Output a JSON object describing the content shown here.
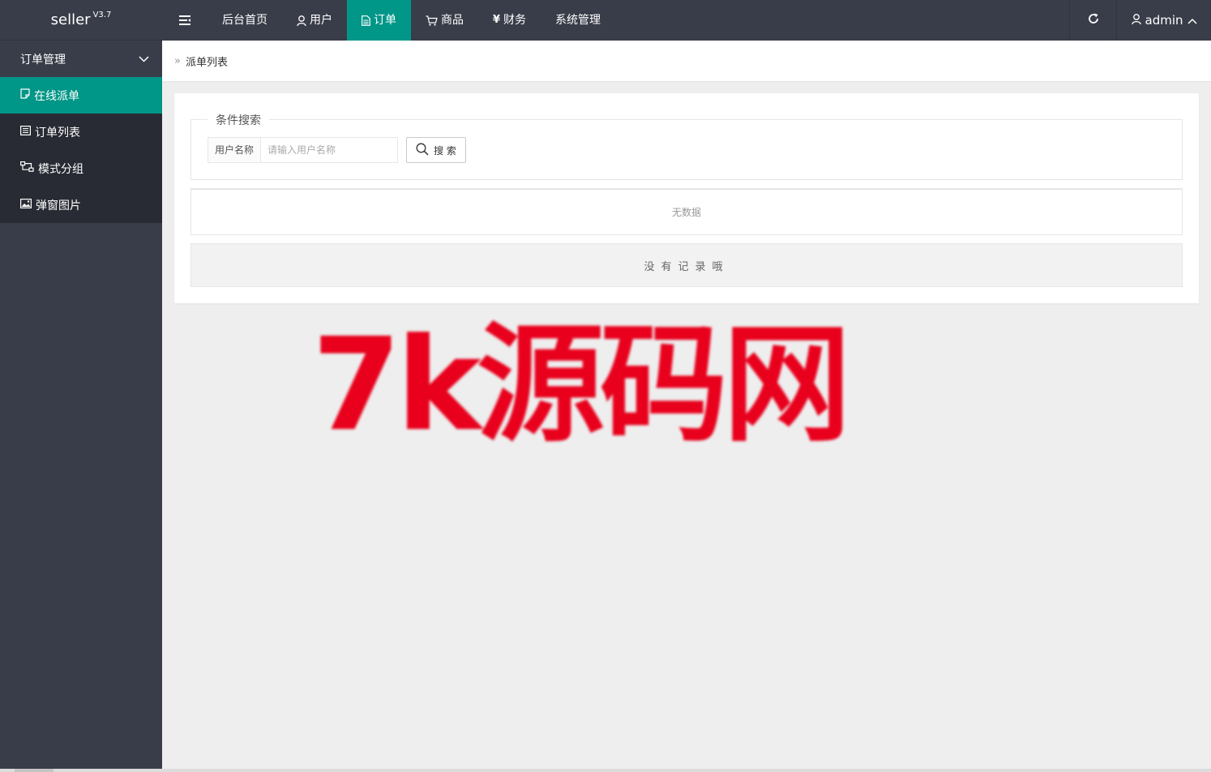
{
  "logo": {
    "name": "seller",
    "version": "V3.7"
  },
  "topnav": {
    "toggle_icon": "menu-toggle-icon",
    "items": [
      {
        "label": "后台首页",
        "icon": ""
      },
      {
        "label": "用户",
        "icon": "user-icon"
      },
      {
        "label": "订单",
        "icon": "file-icon",
        "active": true
      },
      {
        "label": "商品",
        "icon": "cart-icon"
      },
      {
        "label": "财务",
        "icon": "yen-icon"
      },
      {
        "label": "系统管理",
        "icon": ""
      }
    ]
  },
  "topright": {
    "refresh_icon": "refresh-icon",
    "user_label": "admin"
  },
  "sidebar": {
    "group_label": "订单管理",
    "items": [
      {
        "label": "在线派单",
        "icon": "note-icon",
        "active": true
      },
      {
        "label": "订单列表",
        "icon": "list-icon"
      },
      {
        "label": "模式分组",
        "icon": "group-icon"
      },
      {
        "label": "弹窗图片",
        "icon": "image-icon"
      }
    ]
  },
  "breadcrumb": {
    "current": "派单列表"
  },
  "search": {
    "legend": "条件搜索",
    "field_label": "用户名称",
    "field_value": "",
    "field_placeholder": "请输入用户名称",
    "button_label": "搜 索"
  },
  "table": {
    "empty_text": "无数据"
  },
  "footer_notice": "没有记录哦",
  "watermark": "7k源码网",
  "colors": {
    "header_bg": "#393d49",
    "accent": "#009688",
    "sidebar_sub_bg": "#282b33",
    "watermark": "#e8001c"
  }
}
